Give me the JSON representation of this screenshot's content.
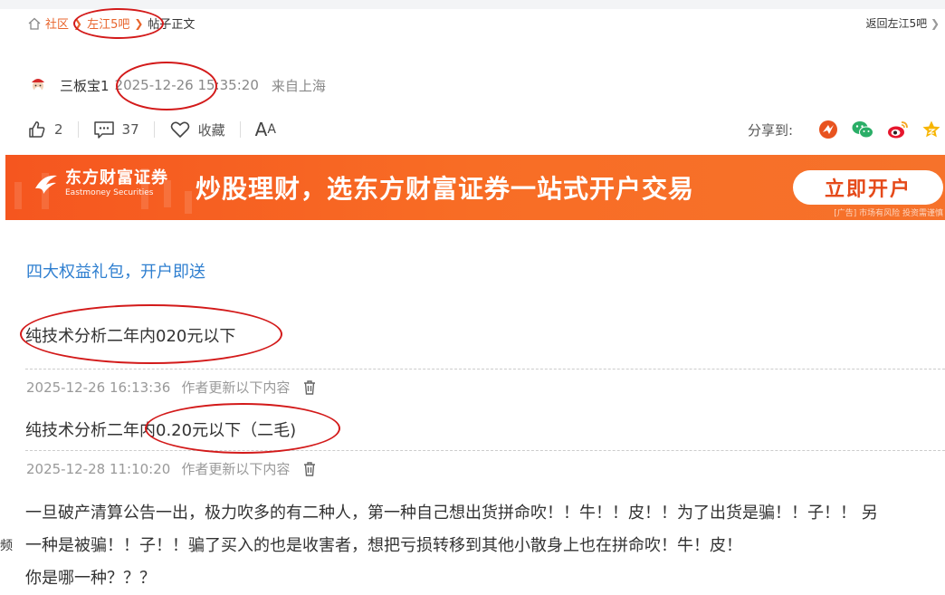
{
  "breadcrumb": {
    "home": "社区",
    "forum": "左江5吧",
    "current": "帖子正文",
    "back": "返回左江5吧"
  },
  "post": {
    "author": "三板宝1",
    "time": "2025-12-26 15:35:20",
    "location": "来自上海"
  },
  "actions": {
    "likes": "2",
    "comments": "37",
    "favorite": "收藏",
    "font_big": "A",
    "font_small": "A"
  },
  "share": {
    "label": "分享到:"
  },
  "banner": {
    "brand_cn": "东方财富证券",
    "brand_en": "Eastmoney Securities",
    "slogan": "炒股理财，选东方财富证券一站式开户交易",
    "button": "立即开户",
    "risk": "[广告] 市场有风险 投资需谨慎"
  },
  "promo_link": "四大权益礼包，开户即送",
  "content": {
    "original": "纯技术分析二年内020元以下",
    "updates": [
      {
        "time": "2025-12-26 16:13:36",
        "label": "作者更新以下内容",
        "text": "纯技术分析二年内0.20元以下（二毛)"
      },
      {
        "time": "2025-12-28 11:10:20",
        "label": "作者更新以下内容",
        "lines": [
          "一旦破产清算公告一出，极力吹多的有二种人，第一种自己想出货拼命吹！！牛！！皮！！为了出货是骗！！子！！ 另",
          "一种是被骗！！子！！骗了买入的也是收害者，想把亏损转移到其他小散身上也在拼命吹！牛！皮！",
          "你是哪一种？？？"
        ]
      }
    ]
  },
  "edge_char": "频",
  "colors": {
    "accent_orange": "#e8642c",
    "link_blue": "#2f7fd0",
    "annotation_red": "#d31a1a"
  }
}
